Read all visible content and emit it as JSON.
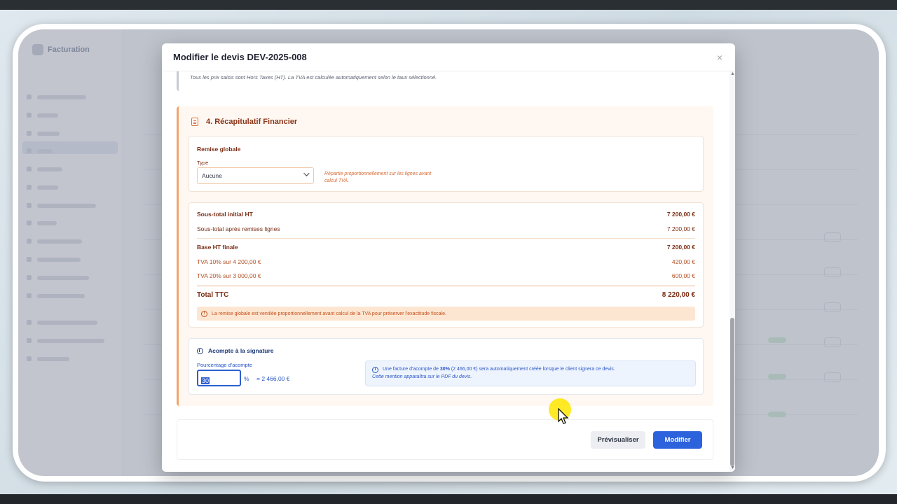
{
  "modal": {
    "title": "Modifier le devis DEV-2025-008",
    "close_label": "×",
    "top_note": "Tous les prix saisis sont Hors Taxes (HT). La TVA est calculée automatiquement selon le taux sélectionné."
  },
  "recap": {
    "title": "4. Récapitulatif Financier",
    "remise": {
      "title": "Remise globale",
      "type_label": "Type",
      "type_value": "Aucune",
      "hint_line1": "Répartie proportionnellement sur les lignes avant",
      "hint_line2": "calcul TVA."
    },
    "totals": [
      {
        "label": "Sous-total initial HT",
        "value": "7 200,00 €"
      },
      {
        "label": "Sous-total après remises lignes",
        "value": "7 200,00 €"
      },
      {
        "label": "Base HT finale",
        "value": "7 200,00 €"
      },
      {
        "label": "TVA 10% sur 4 200,00 €",
        "value": "420,00 €"
      },
      {
        "label": "TVA 20% sur 3 000,00 €",
        "value": "600,00 €"
      }
    ],
    "total_ttc": {
      "label": "Total TTC",
      "value": "8 220,00 €"
    },
    "warning": "La remise globale est ventilée proportionnellement avant calcul de la TVA pour préserver l'exactitude fiscale.",
    "acompte": {
      "title": "Acompte à la signature",
      "pct_label": "Pourcentage d'acompte",
      "pct_value": "30",
      "pct_symbol": "%",
      "amount": "= 2 466,00 €",
      "info_pre": "Une facture d'acompte de ",
      "info_bold": "30%",
      "info_post": " (2 466,00 €) sera automatiquement créée lorsque le client signera ce devis.",
      "info_italic": "Cette mention apparaîtra sur le PDF du devis."
    }
  },
  "footer": {
    "preview_label": "Prévisualiser",
    "modify_label": "Modifier"
  },
  "background_app": {
    "brand": "Facturation"
  },
  "colors": {
    "accent_blue": "#2d62dd",
    "recap_orange": "#f2a36b",
    "text_brown": "#7a2e15"
  }
}
